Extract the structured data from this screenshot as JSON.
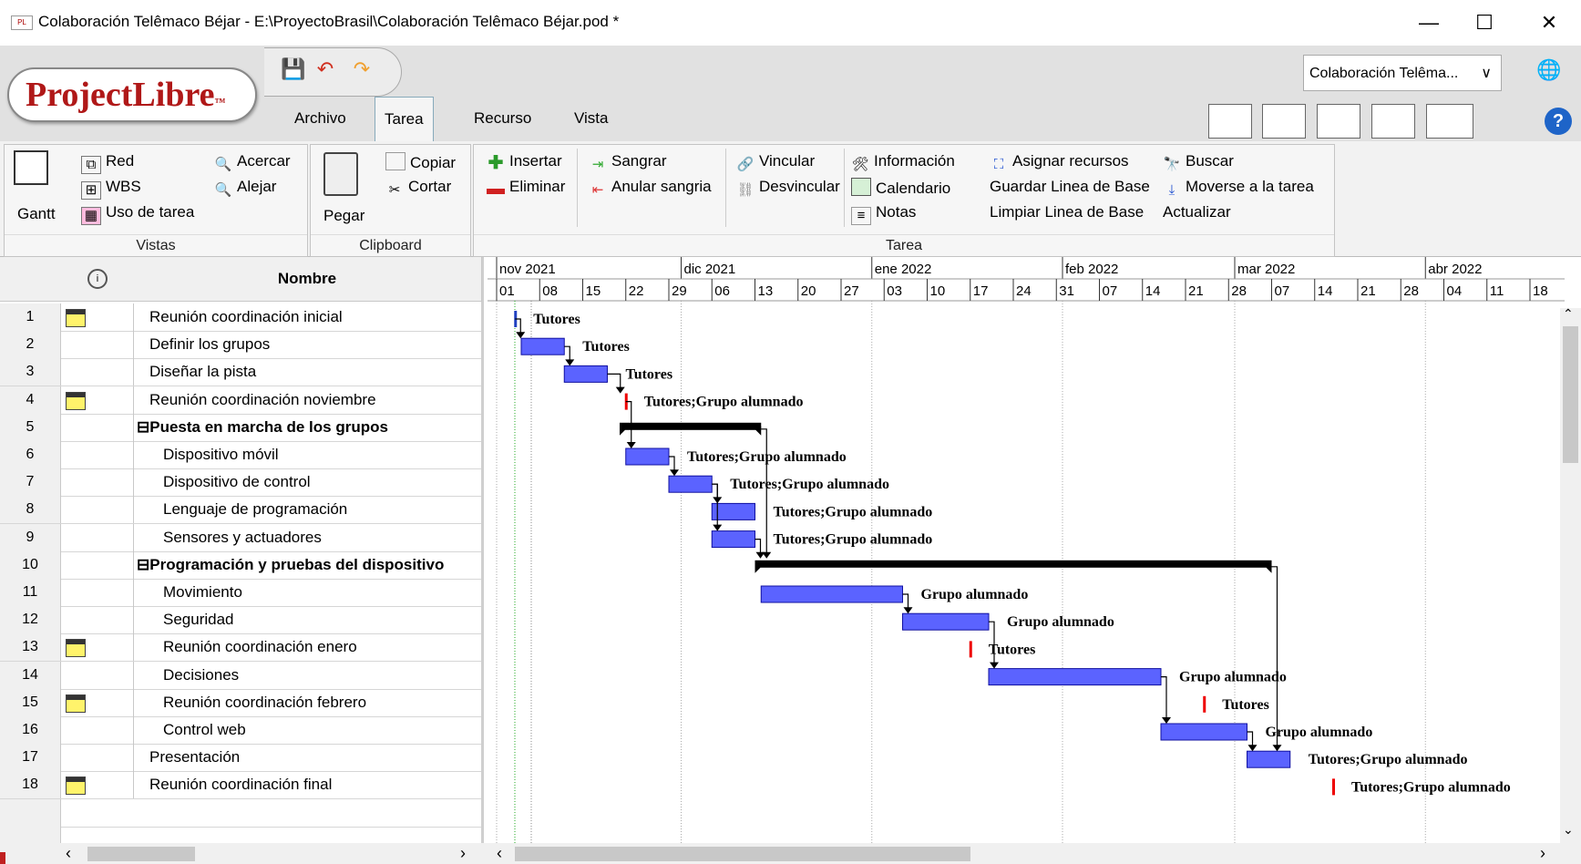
{
  "window": {
    "title": "Colaboración Telêmaco Béjar - E:\\ProyectoBrasil\\Colaboración Telêmaco Béjar.pod *",
    "minimize": "—",
    "maximize": "☐",
    "close": "✕"
  },
  "app": {
    "logo": "ProjectLibre",
    "logo_tm": "™",
    "project_selector": "Colaboración Telêma...",
    "project_selector_arrow": "∨"
  },
  "tabs": [
    "Archivo",
    "Tarea",
    "Recurso",
    "Vista"
  ],
  "ribbon": {
    "vistas": {
      "gantt": "Gantt",
      "red": "Red",
      "wbs": "WBS",
      "uso": "Uso de tarea",
      "acercar": "Acercar",
      "alejar": "Alejar",
      "label": "Vistas"
    },
    "clipboard": {
      "pegar": "Pegar",
      "copiar": "Copiar",
      "cortar": "Cortar",
      "label": "Clipboard"
    },
    "tarea": {
      "insertar": "Insertar",
      "eliminar": "Eliminar",
      "sangrar": "Sangrar",
      "anular": "Anular sangria",
      "vincular": "Vincular",
      "desvincular": "Desvincular",
      "informacion": "Información",
      "calendario": "Calendario",
      "notas": "Notas",
      "asignar": "Asignar recursos",
      "guardar_base": "Guardar Linea de Base",
      "limpiar_base": "Limpiar Linea de Base",
      "buscar": "Buscar",
      "moverse": "Moverse a la tarea",
      "actualizar": "Actualizar",
      "label": "Tarea"
    }
  },
  "table": {
    "header_name": "Nombre",
    "rows": [
      {
        "id": "1",
        "name": "Reunión coordinación inicial",
        "milestone_icon": true,
        "level": 1,
        "summary": false
      },
      {
        "id": "2",
        "name": "Definir los grupos",
        "milestone_icon": false,
        "level": 1,
        "summary": false
      },
      {
        "id": "3",
        "name": "Diseñar la pista",
        "milestone_icon": false,
        "level": 1,
        "summary": false
      },
      {
        "id": "4",
        "name": "Reunión coordinación noviembre",
        "milestone_icon": true,
        "level": 1,
        "summary": false
      },
      {
        "id": "5",
        "name": "Puesta en marcha de los grupos",
        "milestone_icon": false,
        "level": 0,
        "summary": true
      },
      {
        "id": "6",
        "name": "Dispositivo móvil",
        "milestone_icon": false,
        "level": 2,
        "summary": false
      },
      {
        "id": "7",
        "name": "Dispositivo de control",
        "milestone_icon": false,
        "level": 2,
        "summary": false
      },
      {
        "id": "8",
        "name": "Lenguaje de programación",
        "milestone_icon": false,
        "level": 2,
        "summary": false
      },
      {
        "id": "9",
        "name": "Sensores y actuadores",
        "milestone_icon": false,
        "level": 2,
        "summary": false
      },
      {
        "id": "10",
        "name": "Programación y pruebas del dispositivo",
        "milestone_icon": false,
        "level": 0,
        "summary": true
      },
      {
        "id": "11",
        "name": "Movimiento",
        "milestone_icon": false,
        "level": 2,
        "summary": false
      },
      {
        "id": "12",
        "name": "Seguridad",
        "milestone_icon": false,
        "level": 2,
        "summary": false
      },
      {
        "id": "13",
        "name": "Reunión coordinación enero",
        "milestone_icon": true,
        "level": 2,
        "summary": false
      },
      {
        "id": "14",
        "name": "Decisiones",
        "milestone_icon": false,
        "level": 2,
        "summary": false
      },
      {
        "id": "15",
        "name": "Reunión coordinación febrero",
        "milestone_icon": true,
        "level": 2,
        "summary": false
      },
      {
        "id": "16",
        "name": "Control web",
        "milestone_icon": false,
        "level": 2,
        "summary": false
      },
      {
        "id": "17",
        "name": "Presentación",
        "milestone_icon": false,
        "level": 1,
        "summary": false
      },
      {
        "id": "18",
        "name": "Reunión coordinación final",
        "milestone_icon": true,
        "level": 1,
        "summary": false
      }
    ]
  },
  "gantt": {
    "months": [
      "nov 2021",
      "dic 2021",
      "ene 2022",
      "feb 2022",
      "mar 2022",
      "abr 2022"
    ],
    "weeks": [
      "01",
      "08",
      "15",
      "22",
      "29",
      "06",
      "13",
      "20",
      "27",
      "03",
      "10",
      "17",
      "24",
      "31",
      "07",
      "14",
      "21",
      "28",
      "07",
      "14",
      "21",
      "28",
      "04",
      "11",
      "18"
    ],
    "bars": [
      {
        "row": 1,
        "type": "milestone",
        "start": "2021-11-04",
        "label": "Tutores"
      },
      {
        "row": 2,
        "type": "task",
        "start": "2021-11-05",
        "end": "2021-11-12",
        "label": "Tutores"
      },
      {
        "row": 3,
        "type": "task",
        "start": "2021-11-12",
        "end": "2021-11-19",
        "label": "Tutores"
      },
      {
        "row": 4,
        "type": "milestone",
        "start": "2021-11-22",
        "label": "Tutores;Grupo alumnado"
      },
      {
        "row": 5,
        "type": "summary",
        "start": "2021-11-21",
        "end": "2021-12-14",
        "label": ""
      },
      {
        "row": 6,
        "type": "task",
        "start": "2021-11-22",
        "end": "2021-11-29",
        "label": "Tutores;Grupo alumnado"
      },
      {
        "row": 7,
        "type": "task",
        "start": "2021-11-29",
        "end": "2021-12-06",
        "label": "Tutores;Grupo alumnado"
      },
      {
        "row": 8,
        "type": "task",
        "start": "2021-12-06",
        "end": "2021-12-13",
        "label": "Tutores;Grupo alumnado"
      },
      {
        "row": 9,
        "type": "task",
        "start": "2021-12-06",
        "end": "2021-12-13",
        "label": "Tutores;Grupo alumnado"
      },
      {
        "row": 10,
        "type": "summary",
        "start": "2021-12-13",
        "end": "2022-03-07",
        "label": ""
      },
      {
        "row": 11,
        "type": "task",
        "start": "2021-12-14",
        "end": "2022-01-06",
        "label": "Grupo alumnado"
      },
      {
        "row": 12,
        "type": "task",
        "start": "2022-01-06",
        "end": "2022-01-20",
        "label": "Grupo alumnado"
      },
      {
        "row": 13,
        "type": "milestone",
        "start": "2022-01-17",
        "label": "Tutores"
      },
      {
        "row": 14,
        "type": "task",
        "start": "2022-01-20",
        "end": "2022-02-17",
        "label": "Grupo alumnado"
      },
      {
        "row": 15,
        "type": "milestone",
        "start": "2022-02-24",
        "label": "Tutores"
      },
      {
        "row": 16,
        "type": "task",
        "start": "2022-02-17",
        "end": "2022-03-03",
        "label": "Grupo alumnado"
      },
      {
        "row": 17,
        "type": "task",
        "start": "2022-03-03",
        "end": "2022-03-10",
        "label": "Tutores;Grupo alumnado"
      },
      {
        "row": 18,
        "type": "milestone",
        "start": "2022-03-17",
        "label": "Tutores;Grupo alumnado"
      }
    ]
  },
  "colors": {
    "task_fill": "#5b63ff",
    "summary": "#000000",
    "milestone": "#ee0000",
    "logo_red": "#b01818"
  }
}
